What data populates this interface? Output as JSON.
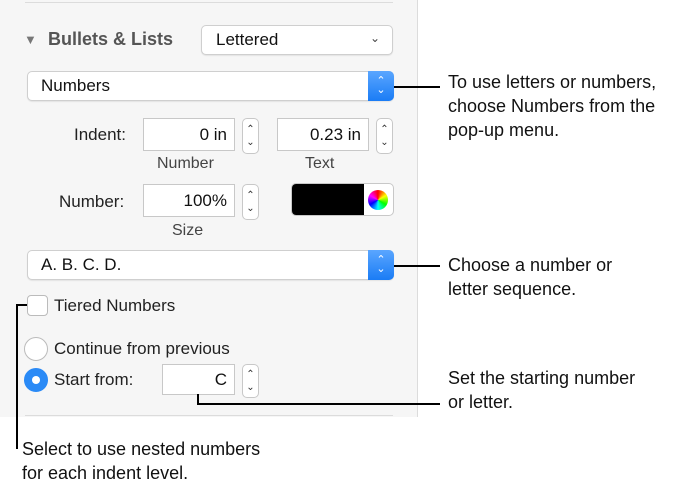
{
  "panel": {
    "section_title": "Bullets & Lists",
    "list_style": "Lettered",
    "bullet_type": "Numbers",
    "indent_label": "Indent:",
    "indent_number_value": "0 in",
    "indent_number_caption": "Number",
    "indent_text_value": "0.23 in",
    "indent_text_caption": "Text",
    "number_label": "Number:",
    "number_size_value": "100%",
    "number_size_caption": "Size",
    "number_color": "#000000",
    "sequence": "A. B. C. D.",
    "tiered_label": "Tiered Numbers",
    "tiered_checked": false,
    "continue_label": "Continue from previous",
    "start_label": "Start from:",
    "start_value": "C",
    "accent": "#2a8af6"
  },
  "callouts": {
    "numbers": [
      "To use letters or numbers,",
      "choose Numbers from the",
      "pop-up menu."
    ],
    "sequence": [
      "Choose a number or",
      "letter sequence."
    ],
    "start": [
      "Set the starting number",
      "or letter."
    ],
    "tiered": [
      "Select to use nested numbers",
      "for each indent level."
    ]
  }
}
